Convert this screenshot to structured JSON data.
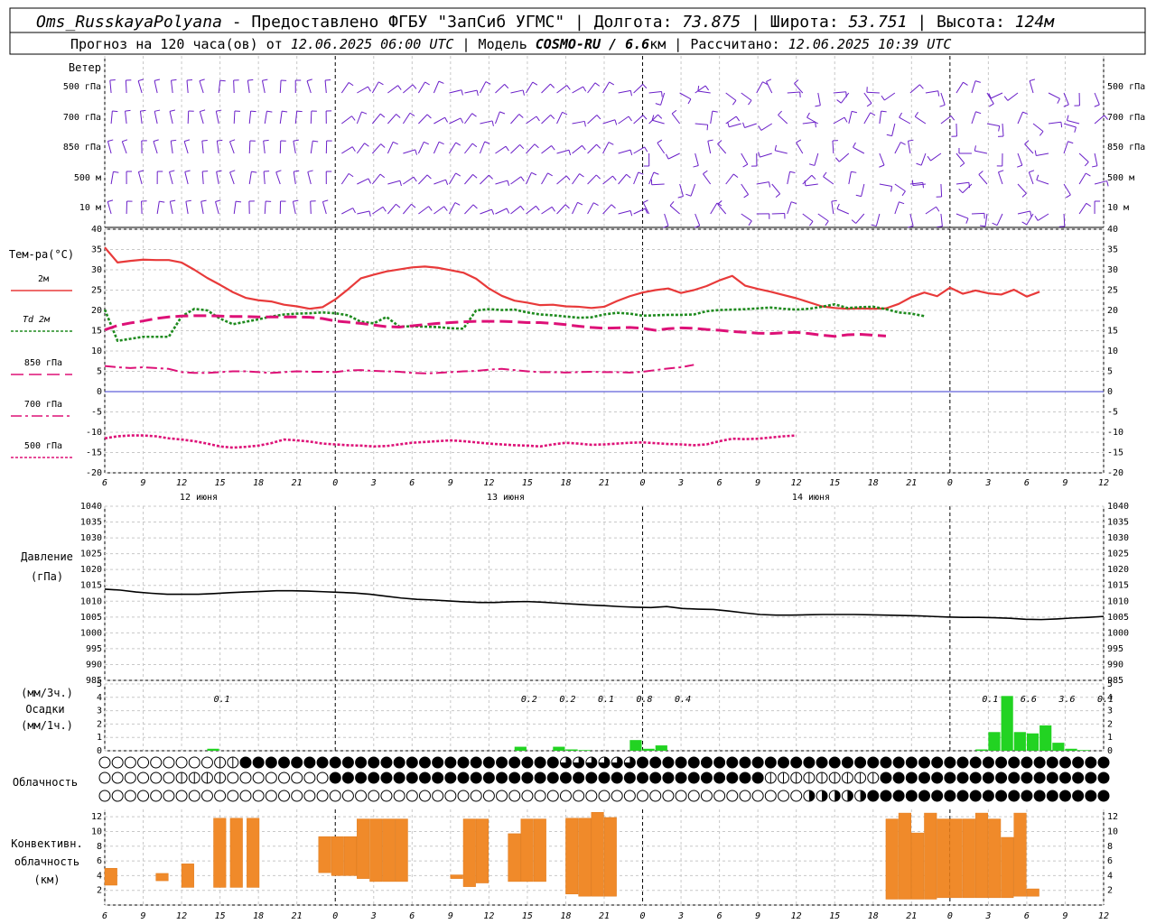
{
  "header": {
    "station": "Oms_RusskayaPolyana",
    "line1_rest": " - Предоставлено ФГБУ \"ЗапСиб УГМС\" | Долгота: ",
    "lon": "73.875",
    "lat_label": " | Широта: ",
    "lat": "53.751",
    "alt_label": " | Высота: ",
    "alt": "124м",
    "line2_a": "Прогноз на 120 часа(ов) от ",
    "run": "12.06.2025 06:00 UTC",
    "line2_b": " | Модель ",
    "model": "COSMO-RU / 6.6",
    "model_unit": "км",
    "line2_c": " | Рассчитано: ",
    "calc": "12.06.2025 10:39 UTC"
  },
  "wind_panel": {
    "title": "Ветер",
    "levels": [
      "500 гПа",
      "700 гПа",
      "850 гПа",
      "500 м",
      "10 м"
    ]
  },
  "temp_panel": {
    "title": "Тем-ра(°С)",
    "legend": [
      {
        "label": "2м",
        "color": "#e83a3a"
      },
      {
        "label": "Td 2м",
        "color": "#1e8a1e"
      },
      {
        "label": "850 гПа",
        "color": "#dd1177"
      },
      {
        "label": "700 гПа",
        "color": "#dd1177"
      },
      {
        "label": "500 гПа",
        "color": "#dd1177"
      }
    ]
  },
  "pressure_panel": {
    "title1": "Давление",
    "title2": "(гПа)"
  },
  "precip_panel": {
    "title1": "(мм/3ч.)",
    "title2": "Осадки",
    "title3": "(мм/1ч.)",
    "totals": [
      {
        "x": 9,
        "text": "0.1"
      },
      {
        "x": 33,
        "text": "0.2"
      },
      {
        "x": 36,
        "text": "0.2"
      },
      {
        "x": 39,
        "text": "0.1"
      },
      {
        "x": 42,
        "text": "0.8"
      },
      {
        "x": 45,
        "text": "0.4"
      },
      {
        "x": 69,
        "text": "0.1"
      },
      {
        "x": 72,
        "text": "6.6"
      },
      {
        "x": 75,
        "text": "3.6"
      },
      {
        "x": 78,
        "text": "0.1"
      }
    ]
  },
  "cloud_panel": {
    "title": "Облачность"
  },
  "conv_panel": {
    "title1": "Конвективн.",
    "title2": "облачность",
    "title3": "(км)"
  },
  "time_axis": {
    "hour_labels": [
      "6",
      "9",
      "12",
      "15",
      "18",
      "21",
      "0",
      "3",
      "6",
      "9",
      "12",
      "15",
      "18",
      "21",
      "0",
      "3",
      "6",
      "9",
      "12",
      "15",
      "18",
      "21",
      "0",
      "3",
      "6",
      "9",
      "12"
    ],
    "day_labels": [
      "12 июня",
      "13 июня",
      "14 июня"
    ]
  },
  "chart_data": [
    {
      "type": "line",
      "title": "Тем-ра(°С)",
      "x": [
        0,
        1,
        2,
        3,
        4,
        5,
        6,
        7,
        8,
        9,
        10,
        11,
        12,
        13,
        14,
        15,
        16,
        17,
        18,
        19,
        20,
        21,
        22,
        23,
        24,
        25,
        26,
        27,
        28,
        29,
        30,
        31,
        32,
        33,
        34,
        35,
        36,
        37,
        38,
        39,
        40,
        41,
        42,
        43,
        44,
        45,
        46,
        47,
        48,
        49,
        50,
        51,
        52,
        53,
        54,
        55,
        56,
        57,
        58,
        59,
        60,
        61,
        62,
        63,
        64,
        65,
        66,
        67,
        68,
        69,
        70,
        71,
        72,
        73,
        74,
        75,
        76,
        77,
        78
      ],
      "x_unit": "hours since 12.06.2025 06:00 UTC",
      "ylim": [
        -20,
        40
      ],
      "series": [
        {
          "name": "2м",
          "values": [
            35.5,
            31.8,
            32.2,
            32.5,
            32.4,
            32.4,
            31.8,
            30.0,
            28.0,
            26.3,
            24.5,
            23.1,
            22.5,
            22.2,
            21.4,
            21.0,
            20.4,
            20.8,
            22.7,
            25.2,
            27.9,
            28.8,
            29.6,
            30.1,
            30.6,
            30.8,
            30.5,
            29.9,
            29.3,
            27.8,
            25.4,
            23.6,
            22.4,
            21.9,
            21.3,
            21.4,
            21.0,
            20.9,
            20.6,
            20.9,
            22.3,
            23.5,
            24.4,
            25.0,
            25.4,
            24.3,
            25.0,
            26.0,
            27.4,
            28.5,
            26.1,
            25.3,
            24.6,
            23.8,
            23.0,
            22.0,
            21.0,
            20.6,
            20.4,
            20.5,
            20.4,
            20.5,
            21.6,
            23.3,
            24.4,
            23.5,
            25.6,
            24.1,
            24.9,
            24.2,
            23.9,
            25.1,
            23.4,
            24.6
          ]
        },
        {
          "name": "Td 2м",
          "values": [
            20.2,
            12.5,
            13.0,
            13.5,
            13.5,
            13.5,
            18.5,
            20.4,
            20.0,
            18.0,
            16.6,
            17.2,
            17.8,
            18.5,
            19.0,
            19.2,
            19.3,
            19.5,
            19.3,
            18.8,
            17.2,
            16.8,
            18.4,
            16.0,
            16.1,
            16.0,
            15.9,
            15.6,
            15.5,
            20.0,
            20.3,
            20.1,
            20.2,
            19.5,
            19.0,
            18.8,
            18.5,
            18.2,
            18.3,
            19.0,
            19.4,
            19.2,
            18.7,
            18.8,
            18.9,
            18.9,
            19.0,
            19.8,
            20.1,
            20.2,
            20.3,
            20.5,
            20.7,
            20.4,
            20.2,
            20.4,
            20.9,
            21.5,
            20.6,
            20.8,
            20.9,
            20.3,
            19.5,
            19.2,
            18.6
          ]
        },
        {
          "name": "850 гПа",
          "values": [
            15.2,
            16.3,
            16.9,
            17.4,
            18.0,
            18.4,
            18.6,
            18.7,
            18.7,
            18.6,
            18.5,
            18.5,
            18.4,
            18.4,
            18.4,
            18.4,
            18.3,
            18.0,
            17.4,
            17.1,
            16.8,
            16.4,
            16.0,
            15.9,
            16.2,
            16.5,
            16.8,
            17.0,
            17.2,
            17.3,
            17.3,
            17.3,
            17.2,
            17.0,
            17.0,
            16.8,
            16.5,
            16.1,
            15.8,
            15.6,
            15.7,
            15.8,
            15.6,
            15.1,
            15.5,
            15.7,
            15.6,
            15.3,
            15.1,
            14.8,
            14.6,
            14.4,
            14.3,
            14.5,
            14.6,
            14.3,
            13.9,
            13.6,
            14.0,
            14.1,
            13.9,
            13.7
          ]
        },
        {
          "name": "700 гПа",
          "values": [
            6.3,
            6.0,
            5.8,
            6.0,
            5.8,
            5.6,
            4.8,
            4.6,
            4.6,
            4.8,
            5.0,
            5.0,
            4.8,
            4.6,
            4.8,
            5.0,
            4.9,
            4.9,
            4.8,
            5.2,
            5.3,
            5.1,
            5.0,
            4.9,
            4.6,
            4.5,
            4.6,
            4.8,
            5.0,
            5.1,
            5.4,
            5.6,
            5.3,
            5.0,
            4.8,
            4.8,
            4.7,
            4.8,
            4.9,
            4.8,
            4.8,
            4.7,
            4.9,
            5.3,
            5.7,
            6.0,
            6.6
          ]
        },
        {
          "name": "500 гПа",
          "values": [
            -11.5,
            -11.0,
            -10.8,
            -10.8,
            -11.0,
            -11.5,
            -11.8,
            -12.2,
            -12.8,
            -13.5,
            -13.8,
            -13.6,
            -13.3,
            -12.7,
            -11.8,
            -12.0,
            -12.3,
            -12.8,
            -13.0,
            -13.2,
            -13.3,
            -13.5,
            -13.4,
            -13.0,
            -12.6,
            -12.4,
            -12.2,
            -12.0,
            -12.2,
            -12.5,
            -12.8,
            -13.0,
            -13.2,
            -13.3,
            -13.5,
            -13.0,
            -12.6,
            -12.8,
            -13.1,
            -13.0,
            -12.8,
            -12.6,
            -12.5,
            -12.7,
            -12.9,
            -13.0,
            -13.2,
            -13.0,
            -12.2,
            -11.6,
            -11.7,
            -11.6,
            -11.3,
            -11.0,
            -10.8
          ]
        }
      ]
    },
    {
      "type": "line",
      "title": "Давление (гПа)",
      "ylim": [
        985,
        1040
      ],
      "series": [
        {
          "name": "Давление",
          "values": [
            1013.8,
            1013.5,
            1012.9,
            1012.5,
            1012.2,
            1012.2,
            1012.2,
            1012.4,
            1012.7,
            1012.9,
            1013.1,
            1013.3,
            1013.3,
            1013.2,
            1013.0,
            1012.8,
            1012.6,
            1012.2,
            1011.6,
            1011.0,
            1010.6,
            1010.4,
            1010.1,
            1009.8,
            1009.6,
            1009.6,
            1009.8,
            1009.9,
            1009.7,
            1009.4,
            1009.1,
            1008.8,
            1008.6,
            1008.3,
            1008.1,
            1008.0,
            1008.3,
            1007.7,
            1007.5,
            1007.4,
            1006.9,
            1006.3,
            1005.8,
            1005.6,
            1005.6,
            1005.7,
            1005.8,
            1005.8,
            1005.8,
            1005.7,
            1005.6,
            1005.5,
            1005.4,
            1005.2,
            1005.0,
            1004.9,
            1004.9,
            1004.8,
            1004.6,
            1004.3,
            1004.2,
            1004.4,
            1004.7,
            1004.9,
            1005.2
          ]
        }
      ]
    },
    {
      "type": "bar",
      "title": "Осадки (мм/1ч.)",
      "ylim": [
        0,
        5
      ],
      "bars": [
        {
          "x": 8.5,
          "w": 1.0,
          "v": 0.15
        },
        {
          "x": 32.5,
          "w": 1.0,
          "v": 0.3
        },
        {
          "x": 35.5,
          "w": 1.0,
          "v": 0.3
        },
        {
          "x": 36.5,
          "w": 1.0,
          "v": 0.1
        },
        {
          "x": 37.5,
          "w": 1.0,
          "v": 0.05
        },
        {
          "x": 41.5,
          "w": 1.0,
          "v": 0.8
        },
        {
          "x": 42.5,
          "w": 1.0,
          "v": 0.15
        },
        {
          "x": 43.5,
          "w": 1.0,
          "v": 0.4
        },
        {
          "x": 68.5,
          "w": 1.0,
          "v": 0.1
        },
        {
          "x": 69.5,
          "w": 1.0,
          "v": 1.4
        },
        {
          "x": 70.5,
          "w": 1.0,
          "v": 4.1
        },
        {
          "x": 71.5,
          "w": 1.0,
          "v": 1.4
        },
        {
          "x": 72.5,
          "w": 1.0,
          "v": 1.3
        },
        {
          "x": 73.5,
          "w": 1.0,
          "v": 1.9
        },
        {
          "x": 74.5,
          "w": 1.0,
          "v": 0.6
        },
        {
          "x": 75.5,
          "w": 1.0,
          "v": 0.15
        },
        {
          "x": 76.5,
          "w": 1.0,
          "v": 0.05
        }
      ]
    },
    {
      "type": "bar",
      "title": "Конвективн. облачность (км)",
      "ylim": [
        0,
        13
      ],
      "bars": [
        {
          "x": 0.5,
          "lo": 2.7,
          "hi": 5.0
        },
        {
          "x": 4.5,
          "lo": 3.3,
          "hi": 4.3
        },
        {
          "x": 6.5,
          "lo": 2.4,
          "hi": 5.6
        },
        {
          "x": 9.0,
          "lo": 2.4,
          "hi": 11.8
        },
        {
          "x": 10.3,
          "lo": 2.4,
          "hi": 11.8
        },
        {
          "x": 11.6,
          "lo": 2.4,
          "hi": 11.8
        },
        {
          "x": 17.2,
          "lo": 4.4,
          "hi": 9.3
        },
        {
          "x": 18.2,
          "lo": 4.0,
          "hi": 9.3
        },
        {
          "x": 19.2,
          "lo": 4.0,
          "hi": 9.3
        },
        {
          "x": 20.2,
          "lo": 3.6,
          "hi": 11.7
        },
        {
          "x": 21.2,
          "lo": 3.2,
          "hi": 11.7
        },
        {
          "x": 22.2,
          "lo": 3.2,
          "hi": 11.7
        },
        {
          "x": 23.2,
          "lo": 3.2,
          "hi": 11.7
        },
        {
          "x": 27.5,
          "lo": 3.6,
          "hi": 4.1
        },
        {
          "x": 28.5,
          "lo": 2.5,
          "hi": 11.7
        },
        {
          "x": 29.5,
          "lo": 3.0,
          "hi": 11.7
        },
        {
          "x": 32.0,
          "lo": 3.2,
          "hi": 9.7
        },
        {
          "x": 33.0,
          "lo": 3.2,
          "hi": 11.7
        },
        {
          "x": 34.0,
          "lo": 3.2,
          "hi": 11.7
        },
        {
          "x": 36.5,
          "lo": 1.5,
          "hi": 11.8
        },
        {
          "x": 37.5,
          "lo": 1.2,
          "hi": 11.8
        },
        {
          "x": 38.5,
          "lo": 1.2,
          "hi": 12.6
        },
        {
          "x": 39.5,
          "lo": 1.2,
          "hi": 11.9
        },
        {
          "x": 61.5,
          "lo": 0.8,
          "hi": 11.7
        },
        {
          "x": 62.5,
          "lo": 0.8,
          "hi": 12.5
        },
        {
          "x": 63.5,
          "lo": 0.8,
          "hi": 9.8
        },
        {
          "x": 64.5,
          "lo": 0.8,
          "hi": 12.5
        },
        {
          "x": 65.5,
          "lo": 1.0,
          "hi": 11.7
        },
        {
          "x": 66.5,
          "lo": 1.0,
          "hi": 11.7
        },
        {
          "x": 67.5,
          "lo": 1.0,
          "hi": 11.7
        },
        {
          "x": 68.5,
          "lo": 1.0,
          "hi": 12.5
        },
        {
          "x": 69.5,
          "lo": 1.0,
          "hi": 11.7
        },
        {
          "x": 70.5,
          "lo": 1.0,
          "hi": 9.2
        },
        {
          "x": 71.5,
          "lo": 1.2,
          "hi": 12.5
        },
        {
          "x": 72.5,
          "lo": 1.2,
          "hi": 2.2
        }
      ]
    }
  ]
}
